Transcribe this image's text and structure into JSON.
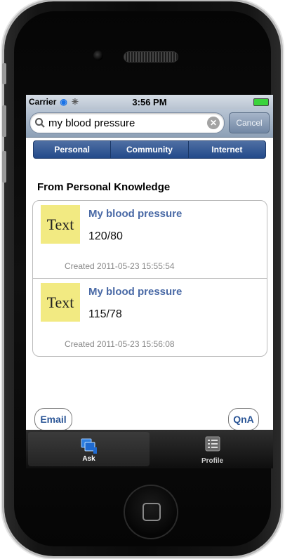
{
  "status": {
    "carrier": "Carrier",
    "time": "3:56 PM"
  },
  "search": {
    "value": "my blood pressure",
    "cancel_label": "Cancel"
  },
  "segments": [
    "Personal",
    "Community",
    "Internet"
  ],
  "section_title": "From Personal Knowledge",
  "results": [
    {
      "thumb_label": "Text",
      "title": "My blood pressure",
      "value": "120/80",
      "created": "Created 2011-05-23 15:55:54"
    },
    {
      "thumb_label": "Text",
      "title": "My blood pressure",
      "value": "115/78",
      "created": "Created 2011-05-23 15:56:08"
    }
  ],
  "buttons": {
    "email": "Email",
    "qna": "QnA"
  },
  "tabbar": {
    "ask": "Ask",
    "profile": "Profile"
  }
}
